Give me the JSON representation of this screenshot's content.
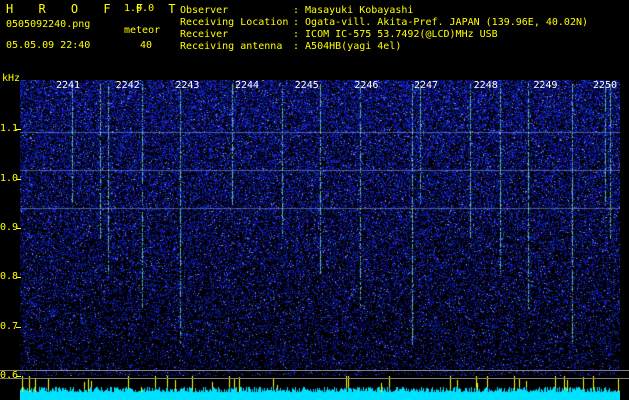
{
  "header": {
    "logo": "H R O F F T",
    "version": "1.0.0",
    "filename": "0505092240.png",
    "meteor_label": "meteor",
    "datetime": "05.05.09 22:40",
    "meteor_count": "40"
  },
  "info": [
    {
      "key": "Observer",
      "value": ": Masayuki Kobayashi"
    },
    {
      "key": "Receiving Location",
      "value": ": Ogata-vill. Akita-Pref. JAPAN (139.96E, 40.02N)"
    },
    {
      "key": "Receiver",
      "value": ": ICOM IC-575 53.7492(@LCD)MHz USB"
    },
    {
      "key": "Receiving antenna",
      "value": ": A504HB(yagi 4el)"
    }
  ],
  "yaxis": {
    "unit": "kHz",
    "ticks": [
      "1.1",
      "1.0",
      "0.9",
      "0.8",
      "0.7",
      "0.6"
    ],
    "tick_values": [
      1.1,
      1.0,
      0.9,
      0.8,
      0.7,
      0.6
    ],
    "range": [
      0.6,
      1.2
    ]
  },
  "xaxis": {
    "minutes": [
      "2241",
      "2242",
      "2243",
      "2244",
      "2245",
      "2246",
      "2247",
      "2248",
      "2249",
      "2250"
    ]
  },
  "colors": {
    "text": "#ffff00",
    "background": "#000000",
    "noise_low": "#000080",
    "noise_high": "#4040ff",
    "meteor": "#80ff80",
    "baseline": "#00e0ff"
  }
}
